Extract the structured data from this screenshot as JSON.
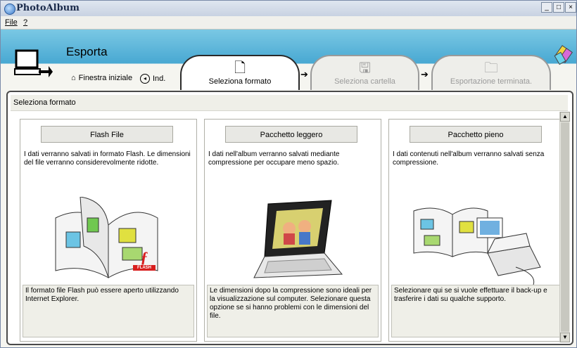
{
  "window": {
    "title": "PhotoAlbum",
    "controls": [
      "_",
      "□",
      "×"
    ]
  },
  "menu": {
    "file": "File",
    "help": "?"
  },
  "header": {
    "title": "Esporta",
    "home_link": "Finestra iniziale",
    "index_link": "Ind."
  },
  "steps": [
    {
      "label": "Seleziona formato",
      "state": "active"
    },
    {
      "label": "Seleziona cartella",
      "state": "inactive"
    },
    {
      "label": "Esportazione terminata.",
      "state": "inactive"
    }
  ],
  "section": {
    "title": "Seleziona formato"
  },
  "panels": [
    {
      "button": "Flash File",
      "description": "I dati verranno salvati in formato Flash. Le dimensioni del file verranno considerevolmente ridotte.",
      "note": "Il formato file Flash può essere aperto utilizzando Internet Explorer.",
      "logo_text": "FLASH"
    },
    {
      "button": "Pacchetto leggero",
      "description": "I dati nell'album verranno salvati mediante compressione per occupare meno spazio.",
      "note": "Le dimensioni dopo la compressione sono ideali per la visualizzazione sul computer. Selezionare questa opzione se si hanno problemi con le dimensioni del file."
    },
    {
      "button": "Pacchetto pieno",
      "description": "I dati contenuti nell'album verranno salvati senza compressione.",
      "note": "Selezionare qui se si vuole effettuare il back-up e trasferire i dati su qualche supporto."
    }
  ],
  "colors": {
    "header_blue": "#48a8d2",
    "flash_red": "#d81e1e"
  }
}
